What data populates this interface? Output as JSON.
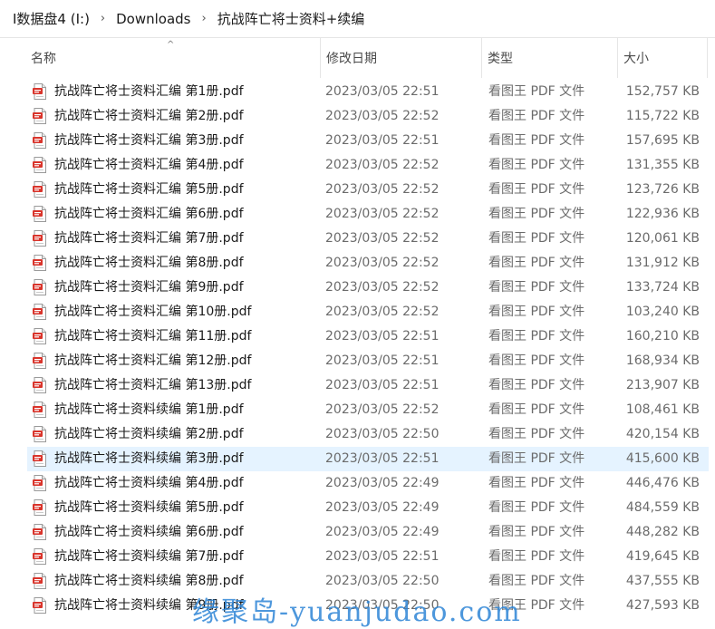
{
  "breadcrumb": {
    "drive": "I数据盘4 (I:)",
    "folder1": "Downloads",
    "folder2": "抗战阵亡将士资料+续编",
    "separator": "›"
  },
  "columns": {
    "name": "名称",
    "date": "修改日期",
    "type": "类型",
    "size": "大小",
    "sort_indicator": "^"
  },
  "files": [
    {
      "name": "抗战阵亡将士资料汇编  第1册.pdf",
      "date": "2023/03/05 22:51",
      "type": "看图王 PDF 文件",
      "size": "152,757 KB"
    },
    {
      "name": "抗战阵亡将士资料汇编  第2册.pdf",
      "date": "2023/03/05 22:52",
      "type": "看图王 PDF 文件",
      "size": "115,722 KB"
    },
    {
      "name": "抗战阵亡将士资料汇编  第3册.pdf",
      "date": "2023/03/05 22:51",
      "type": "看图王 PDF 文件",
      "size": "157,695 KB"
    },
    {
      "name": "抗战阵亡将士资料汇编  第4册.pdf",
      "date": "2023/03/05 22:52",
      "type": "看图王 PDF 文件",
      "size": "131,355 KB"
    },
    {
      "name": "抗战阵亡将士资料汇编  第5册.pdf",
      "date": "2023/03/05 22:52",
      "type": "看图王 PDF 文件",
      "size": "123,726 KB"
    },
    {
      "name": "抗战阵亡将士资料汇编  第6册.pdf",
      "date": "2023/03/05 22:52",
      "type": "看图王 PDF 文件",
      "size": "122,936 KB"
    },
    {
      "name": "抗战阵亡将士资料汇编  第7册.pdf",
      "date": "2023/03/05 22:52",
      "type": "看图王 PDF 文件",
      "size": "120,061 KB"
    },
    {
      "name": "抗战阵亡将士资料汇编  第8册.pdf",
      "date": "2023/03/05 22:52",
      "type": "看图王 PDF 文件",
      "size": "131,912 KB"
    },
    {
      "name": "抗战阵亡将士资料汇编  第9册.pdf",
      "date": "2023/03/05 22:52",
      "type": "看图王 PDF 文件",
      "size": "133,724 KB"
    },
    {
      "name": "抗战阵亡将士资料汇编  第10册.pdf",
      "date": "2023/03/05 22:52",
      "type": "看图王 PDF 文件",
      "size": "103,240 KB"
    },
    {
      "name": "抗战阵亡将士资料汇编  第11册.pdf",
      "date": "2023/03/05 22:51",
      "type": "看图王 PDF 文件",
      "size": "160,210 KB"
    },
    {
      "name": "抗战阵亡将士资料汇编  第12册.pdf",
      "date": "2023/03/05 22:51",
      "type": "看图王 PDF 文件",
      "size": "168,934 KB"
    },
    {
      "name": "抗战阵亡将士资料汇编  第13册.pdf",
      "date": "2023/03/05 22:51",
      "type": "看图王 PDF 文件",
      "size": "213,907 KB"
    },
    {
      "name": "抗战阵亡将士资料续编 第1册.pdf",
      "date": "2023/03/05 22:52",
      "type": "看图王 PDF 文件",
      "size": "108,461 KB"
    },
    {
      "name": "抗战阵亡将士资料续编 第2册.pdf",
      "date": "2023/03/05 22:50",
      "type": "看图王 PDF 文件",
      "size": "420,154 KB"
    },
    {
      "name": "抗战阵亡将士资料续编 第3册.pdf",
      "date": "2023/03/05 22:51",
      "type": "看图王 PDF 文件",
      "size": "415,600 KB",
      "selected": true
    },
    {
      "name": "抗战阵亡将士资料续编 第4册.pdf",
      "date": "2023/03/05 22:49",
      "type": "看图王 PDF 文件",
      "size": "446,476 KB"
    },
    {
      "name": "抗战阵亡将士资料续编 第5册.pdf",
      "date": "2023/03/05 22:49",
      "type": "看图王 PDF 文件",
      "size": "484,559 KB"
    },
    {
      "name": "抗战阵亡将士资料续编 第6册.pdf",
      "date": "2023/03/05 22:49",
      "type": "看图王 PDF 文件",
      "size": "448,282 KB"
    },
    {
      "name": "抗战阵亡将士资料续编 第7册.pdf",
      "date": "2023/03/05 22:51",
      "type": "看图王 PDF 文件",
      "size": "419,645 KB"
    },
    {
      "name": "抗战阵亡将士资料续编 第8册.pdf",
      "date": "2023/03/05 22:50",
      "type": "看图王 PDF 文件",
      "size": "437,555 KB"
    },
    {
      "name": "抗战阵亡将士资料续编 第9册.pdf",
      "date": "2023/03/05 22:50",
      "type": "看图王 PDF 文件",
      "size": "427,593 KB"
    }
  ],
  "icons": {
    "file": "pdf-file-icon"
  },
  "colors": {
    "selection": "#e5f3ff",
    "pdf_red": "#d9342b",
    "watermark": "#2f86d6"
  },
  "watermark": "缘聚岛-yuanjudao.com"
}
